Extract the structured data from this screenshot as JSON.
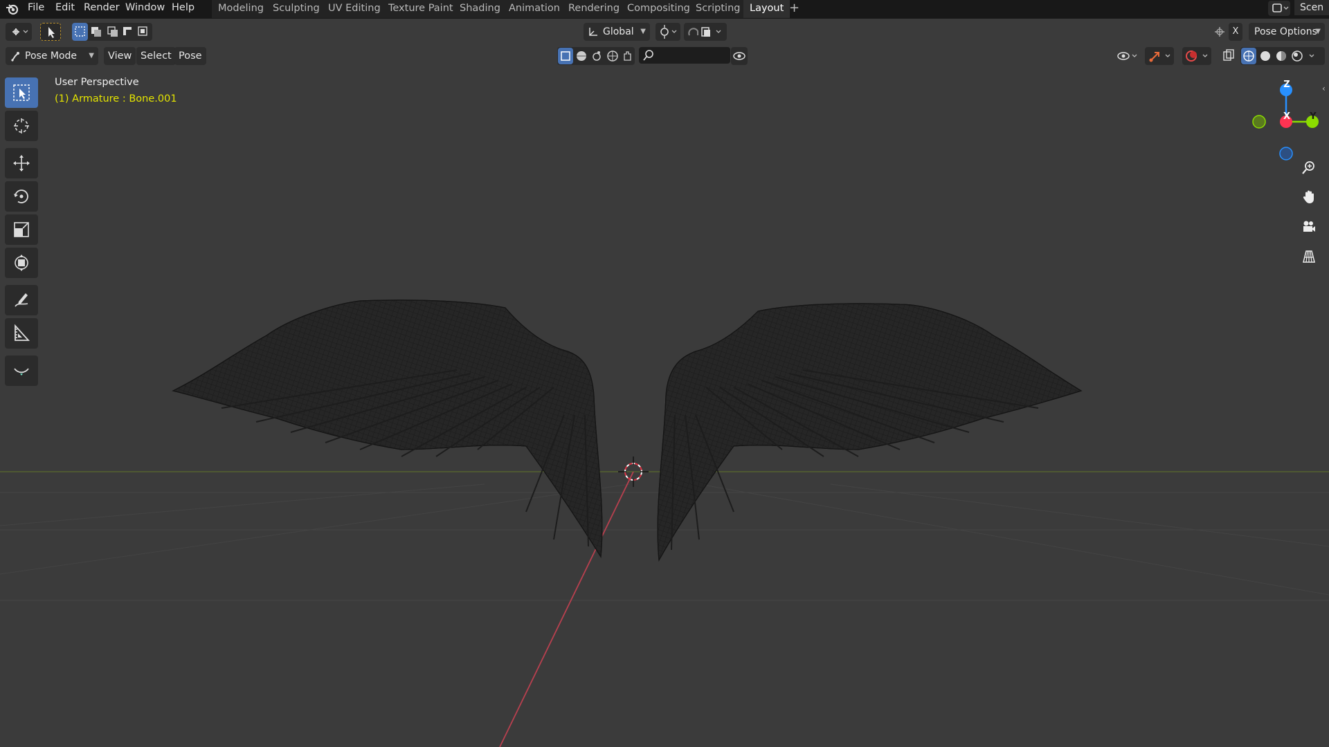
{
  "menu": {
    "items": [
      "File",
      "Edit",
      "Render",
      "Window",
      "Help"
    ]
  },
  "workspaces": {
    "tabs": [
      "Modeling",
      "Sculpting",
      "UV Editing",
      "Texture Paint",
      "Shading",
      "Animation",
      "Rendering",
      "Compositing",
      "Scripting",
      "Layout"
    ],
    "active": "Layout",
    "add_label": "+"
  },
  "scene": {
    "label": "Scen"
  },
  "header": {
    "transform_orientation": "Global",
    "pose_options": "Pose Options",
    "x_mirror": "X",
    "mode": "Pose Mode",
    "view": "View",
    "select": "Select",
    "pose": "Pose"
  },
  "viewport": {
    "perspective_label": "User Perspective",
    "active_object": "(1) Armature : Bone.001"
  },
  "gizmo": {
    "x": "X",
    "y": "Y",
    "z": "Z"
  },
  "colors": {
    "active_blue": "#4772b3",
    "active_object_text": "#e5e500",
    "axis_x": "#ff3352",
    "axis_y": "#8bdc00",
    "axis_z": "#2890ff"
  },
  "icons": {
    "toolbar": [
      "select-box-icon",
      "cursor-icon",
      "move-icon",
      "rotate-icon",
      "scale-icon",
      "transform-icon",
      "annotate-icon",
      "measure-icon",
      "bone-envelope-icon"
    ],
    "nav": [
      "zoom-icon",
      "pan-hand-icon",
      "camera-icon",
      "ortho-grid-icon"
    ]
  }
}
